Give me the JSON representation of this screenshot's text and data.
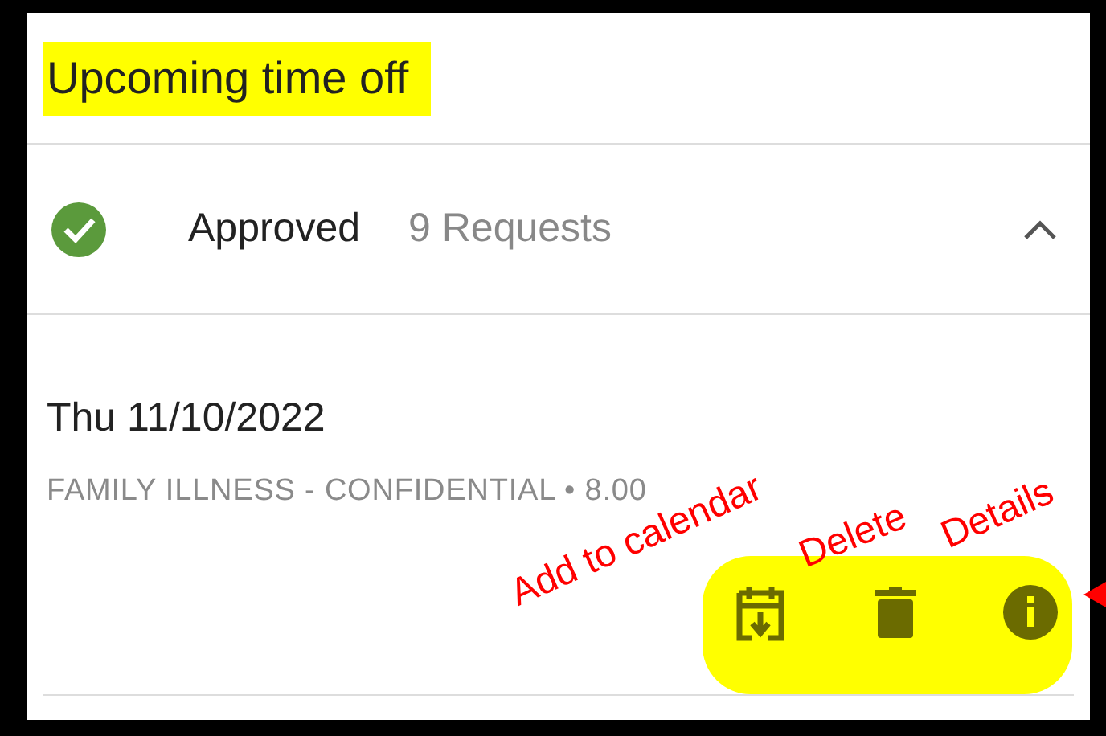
{
  "title": "Upcoming time off",
  "group": {
    "status": "Approved",
    "count": "9 Requests",
    "expanded": true
  },
  "requests": [
    {
      "date": "Thu 11/10/2022",
      "detail": "FAMILY ILLNESS - CONFIDENTIAL • 8.00"
    }
  ],
  "annotations": [
    {
      "text": "Add to calendar"
    },
    {
      "text": "Delete"
    },
    {
      "text": "Details"
    }
  ]
}
